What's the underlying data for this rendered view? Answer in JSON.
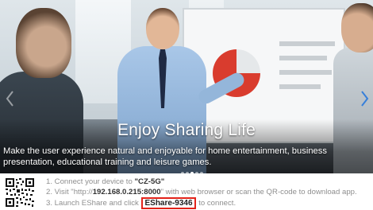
{
  "hero": {
    "title": "Enjoy Sharing Life",
    "subtitle_line1": "Make the user experience natural and enjoyable for home entertainment, business",
    "subtitle_line2": "presentation, educational training and leisure games.",
    "carousel_slides": 5,
    "carousel_active_index": 2
  },
  "instructions": {
    "step1_prefix": "1. Connect your device to ",
    "step1_network": "\"CZ-5G\"",
    "step2_prefix": "2. Visit \"http://",
    "step2_address": "192.168.0.215:8000",
    "step2_suffix": "\" with web browser or scan the QR-code to download app.",
    "step3_prefix": "3. Launch EShare and click",
    "step3_device": "EShare-9346",
    "step3_suffix": "to connect."
  },
  "colors": {
    "highlight_border": "#e2231a",
    "instruction_text": "#8f8f8f"
  },
  "icons": {
    "qr": "qr-code-icon",
    "prev": "chevron-left-icon",
    "next": "chevron-right-icon"
  }
}
